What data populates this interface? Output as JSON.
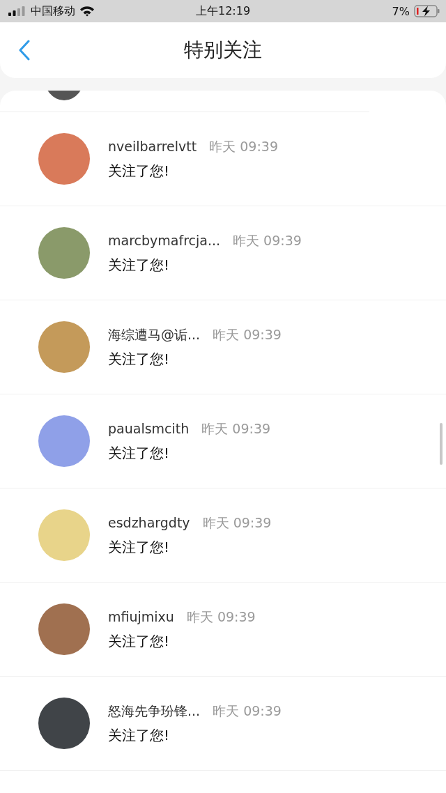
{
  "status_bar": {
    "carrier": "中国移动",
    "time": "上午12:19",
    "battery": "7%"
  },
  "header": {
    "title": "特别关注"
  },
  "notifications": [
    {
      "name": "nveilbarrelvtt",
      "time": "昨天 09:39",
      "message": "关注了您!"
    },
    {
      "name": "marcbymafrcja...",
      "time": "昨天 09:39",
      "message": "关注了您!"
    },
    {
      "name": "海综遭马@诟...",
      "time": "昨天 09:39",
      "message": "关注了您!"
    },
    {
      "name": "paualsmcith",
      "time": "昨天 09:39",
      "message": "关注了您!"
    },
    {
      "name": "esdzhargdty",
      "time": "昨天 09:39",
      "message": "关注了您!"
    },
    {
      "name": "mfiujmixu",
      "time": "昨天 09:39",
      "message": "关注了您!"
    },
    {
      "name": "怒海先争玢锋...",
      "time": "昨天 09:39",
      "message": "关注了您!"
    }
  ]
}
